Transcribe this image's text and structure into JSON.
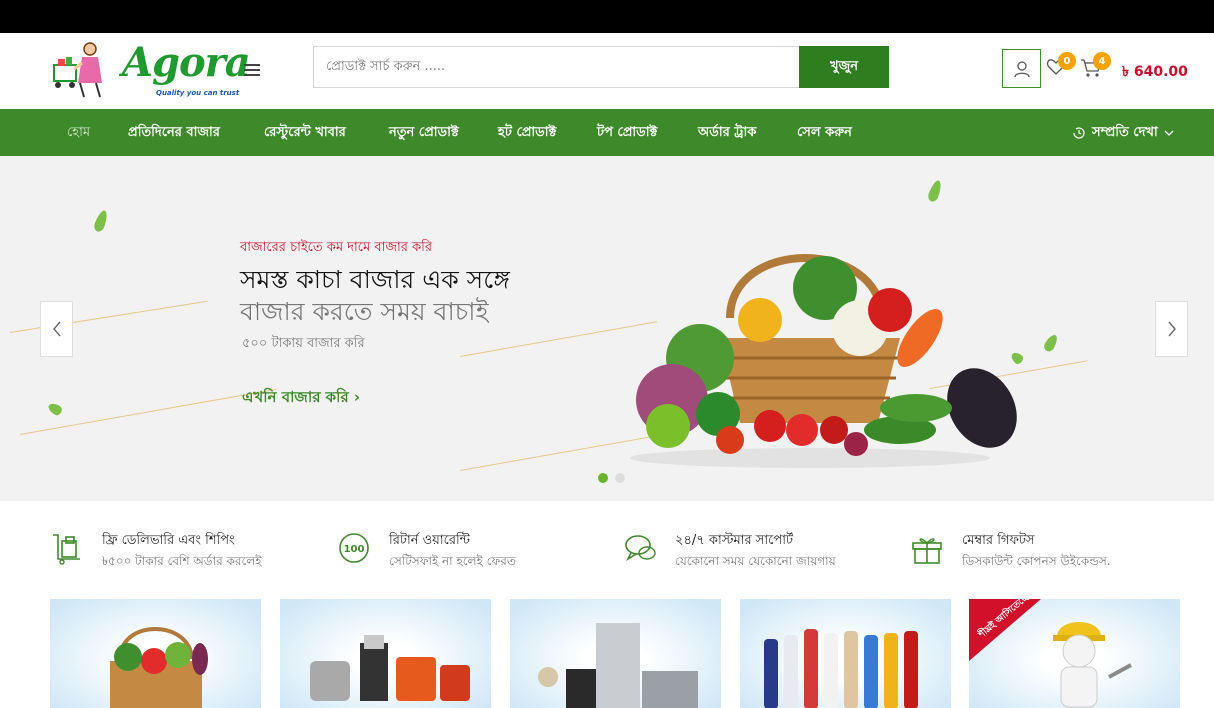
{
  "header": {
    "logo_text": "Agora",
    "logo_tagline": "Quality you can trust",
    "search_placeholder": "প্রোডাক্ট সার্চ করুন .....",
    "search_button": "খুজুন",
    "wishlist_count": "0",
    "cart_count": "4",
    "cart_total": "৳ 640.00"
  },
  "nav": {
    "items": [
      {
        "label": "হোম"
      },
      {
        "label": "প্রতিদিনের বাজার"
      },
      {
        "label": "রেস্টুরেন্ট খাবার"
      },
      {
        "label": "নতুন প্রোডাক্ট"
      },
      {
        "label": "হট প্রোডাক্ট"
      },
      {
        "label": "টপ প্রোডাক্ট"
      },
      {
        "label": "অর্ডার ট্রাক"
      },
      {
        "label": "সেল করুন"
      }
    ],
    "recent_label": "সম্প্রতি দেখা"
  },
  "hero": {
    "subtitle": "বাজারের চাইতে কম দামে বাজার করি",
    "title_line1": "সমস্ত কাচা বাজার এক সঙ্গে",
    "title_line2": "বাজার করতে সময় বাচাই",
    "description": "৫০০ টাকায় বাজার করি",
    "cta": "এখনি বাজার করি ›",
    "active_slide": 1,
    "slide_count": 2
  },
  "features": [
    {
      "title": "ফ্রি ডেলিভারি এবং শিপিং",
      "desc": "৳৫০০ টাকার বেশি অর্ডার করলেই",
      "icon": "delivery-icon"
    },
    {
      "title": "রিটার্ন ওয়ারেন্টি",
      "desc": "সেটিসফাই না হলেই ফেরত",
      "icon": "return-warranty-icon"
    },
    {
      "title": "২৪/৭ কাস্টমার সাপোর্ট",
      "desc": "যেকোনো সময় যেকোনো জায়গায়",
      "icon": "support-chat-icon"
    },
    {
      "title": "মেম্বার গিফটস",
      "desc": "ডিসকাউন্ট কোপনস উইকেন্ডস.",
      "icon": "gift-icon"
    }
  ],
  "categories": [
    {
      "icon": "vegetables-basket-icon"
    },
    {
      "icon": "kitchen-appliances-icon"
    },
    {
      "icon": "electronics-icon"
    },
    {
      "icon": "cosmetics-icon"
    },
    {
      "icon": "service-worker-icon",
      "ribbon": "শীঘ্রই আসিতেছে"
    }
  ],
  "colors": {
    "brand_green": "#3e8a2a",
    "badge_orange": "#f6a200",
    "price_red": "#c8102e"
  }
}
